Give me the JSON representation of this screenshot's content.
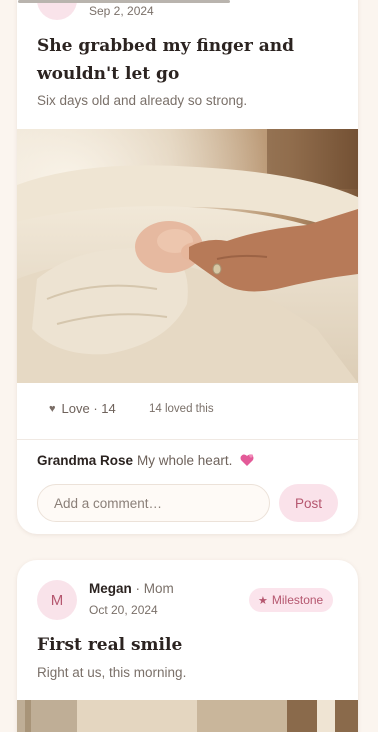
{
  "posts": [
    {
      "date": "Sep 2, 2024",
      "title": "She grabbed my finger and wouldn't let go",
      "caption": "Six days old and already so strong.",
      "photo_icon": "newborn-hand-photo",
      "love_label": "Love · 14",
      "loved_count_text": "14 loved this",
      "comments": [
        {
          "author": "Grandma Rose",
          "text": "My whole heart.",
          "emoji": "two-hearts-icon"
        }
      ],
      "comment_placeholder": "Add a comment…",
      "post_label": "Post"
    },
    {
      "avatar_initial": "M",
      "author": "Megan",
      "separator": "·",
      "role": "Mom",
      "date": "Oct 20, 2024",
      "badge": "Milestone",
      "title": "First real smile",
      "caption": "Right at us, this morning."
    }
  ],
  "colors": {
    "background": "#fbf5ef",
    "accent": "#b5576f",
    "accent_soft": "#fbe4ec",
    "text": "#2b2320",
    "muted": "#7a7069"
  }
}
